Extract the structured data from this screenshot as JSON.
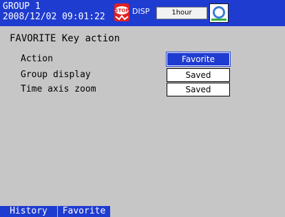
{
  "header": {
    "group": "GROUP 1",
    "datetime": "2008/12/02 09:01:22",
    "stop_icon_label": "STOP",
    "mode": "DISP",
    "interval": "1hour",
    "icons": {
      "stop": "stop-record-icon",
      "card": "memory-card-icon"
    },
    "colors": {
      "bar": "#1f3cd0",
      "stop": "#e02020",
      "card_ring": "#3a7ad8",
      "card_bar": "#2fae3a"
    }
  },
  "page": {
    "title": "FAVORITE Key action",
    "rows": [
      {
        "label": "Action",
        "value": "Favorite",
        "selected": true
      },
      {
        "label": "Group display",
        "value": "Saved",
        "selected": false
      },
      {
        "label": "Time axis zoom",
        "value": "Saved",
        "selected": false
      }
    ]
  },
  "softkeys": [
    {
      "label": "History"
    },
    {
      "label": "Favorite"
    }
  ],
  "colors": {
    "background": "#c6c6c6",
    "selection": "#1f3cd0"
  }
}
